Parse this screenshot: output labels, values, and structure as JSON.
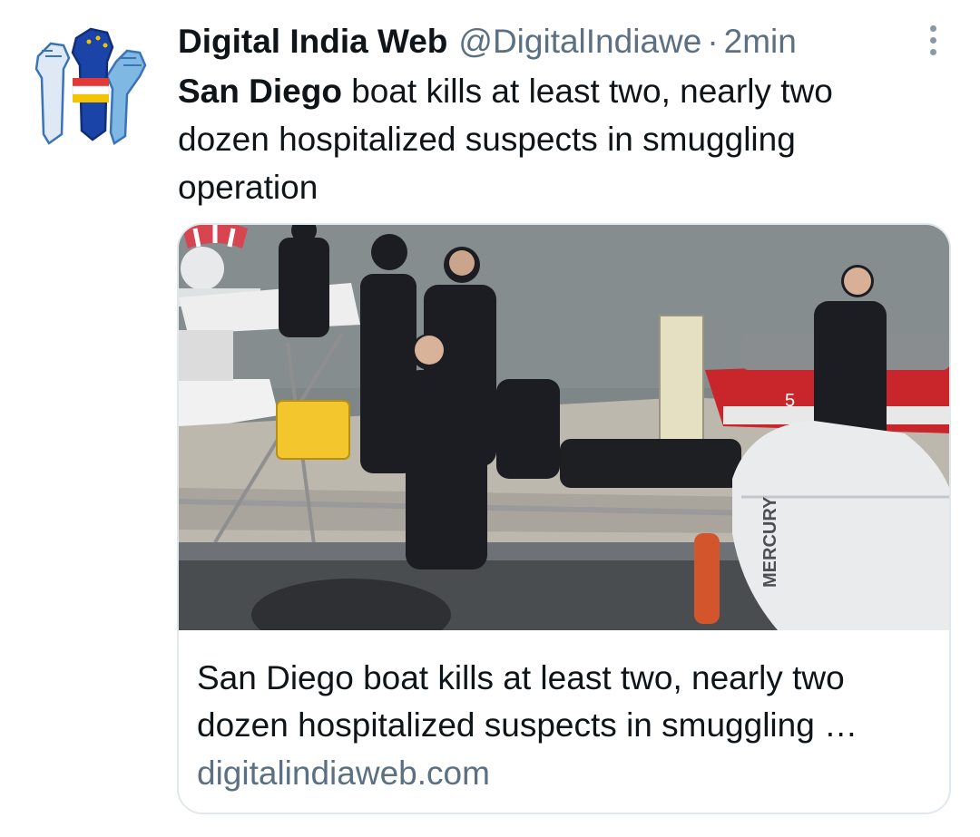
{
  "tweet": {
    "author_name": "Digital India Web",
    "author_handle": "@DigitalIndiawe",
    "separator": "·",
    "time": "2min",
    "text_bold": "San Diego",
    "text_rest": " boat kills at least two, nearly two dozen hospitalized suspects in smuggling operation"
  },
  "card": {
    "title": "San Diego boat kills at least two, nearly two dozen hospitalized suspects in smuggling …",
    "domain": "digitalindiaweb.com",
    "image_alt": "Officers on a boat deck",
    "image_text": {
      "engine_brand": "MERCURY",
      "hull_number": "5"
    }
  },
  "colors": {
    "text_primary": "#0f1419",
    "text_secondary": "#5b7083",
    "card_border": "#e1e8ed",
    "water": "#7f8688",
    "boat_tube": "#4a4d50",
    "uniform": "#1c1d22",
    "red_hull": "#c8262a",
    "yellow_case": "#f2c62c"
  },
  "icons": [
    "avatar-raised-fists-logo",
    "more-vertical-icon"
  ]
}
